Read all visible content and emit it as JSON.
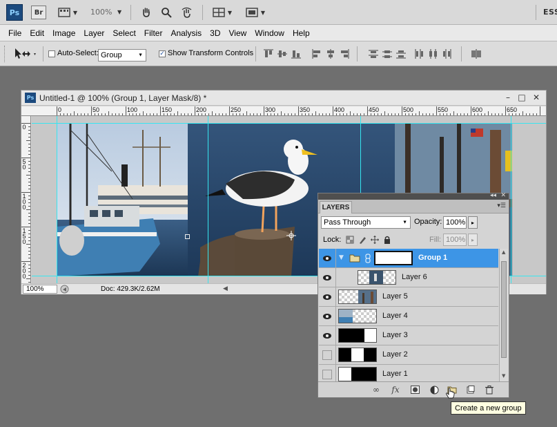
{
  "appbar": {
    "ps_logo": "Ps",
    "br_logo": "Br",
    "zoom": "100%",
    "workspace": "ESS"
  },
  "menu": [
    "File",
    "Edit",
    "Image",
    "Layer",
    "Select",
    "Filter",
    "Analysis",
    "3D",
    "View",
    "Window",
    "Help"
  ],
  "options": {
    "auto_select_label": "Auto-Select:",
    "auto_select_checked": false,
    "auto_select_value": "Group",
    "show_transform_label": "Show Transform Controls",
    "show_transform_checked": true
  },
  "document": {
    "title": "Untitled-1 @ 100% (Group 1, Layer Mask/8) *",
    "zoom": "100%",
    "doc_info": "Doc: 429.3K/2.62M",
    "ruler_h_labels": [
      "0",
      "50",
      "100",
      "150",
      "200",
      "250",
      "300",
      "350",
      "400",
      "450",
      "500",
      "550",
      "600",
      "650"
    ],
    "ruler_v_labels": [
      "0",
      "5\n0",
      "1\n0\n0",
      "1\n5\n0",
      "2\n0\n0"
    ]
  },
  "layers_panel": {
    "tab": "LAYERS",
    "blend_mode": "Pass Through",
    "opacity_label": "Opacity:",
    "opacity": "100%",
    "lock_label": "Lock:",
    "fill_label": "Fill:",
    "fill": "100%",
    "layers": [
      {
        "name": "Group 1",
        "visible": true,
        "selected": true,
        "kind": "group"
      },
      {
        "name": "Layer 6",
        "visible": true,
        "selected": false,
        "kind": "layer-indent"
      },
      {
        "name": "Layer 5",
        "visible": true,
        "selected": false,
        "kind": "layer"
      },
      {
        "name": "Layer 4",
        "visible": true,
        "selected": false,
        "kind": "layer"
      },
      {
        "name": "Layer 3",
        "visible": true,
        "selected": false,
        "kind": "layer"
      },
      {
        "name": "Layer 2",
        "visible": false,
        "selected": false,
        "kind": "layer"
      },
      {
        "name": "Layer 1",
        "visible": false,
        "selected": false,
        "kind": "layer"
      }
    ]
  },
  "tooltip": "Create a new group",
  "colors": {
    "selection": "#3d95e6",
    "guide": "#36e6f0"
  }
}
